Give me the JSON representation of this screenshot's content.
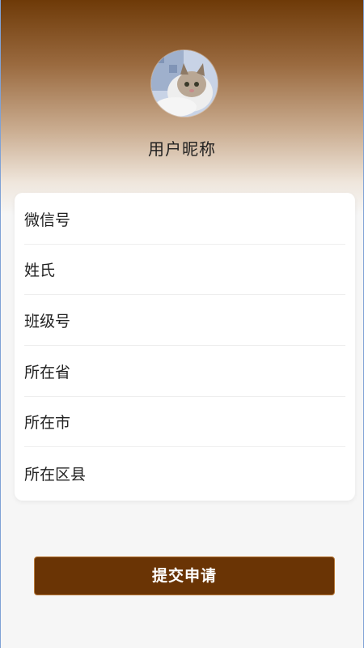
{
  "header": {
    "nickname": "用户昵称",
    "avatar": "cat-photo"
  },
  "form": {
    "fields": [
      {
        "label": "微信号"
      },
      {
        "label": "姓氏"
      },
      {
        "label": "班级号"
      },
      {
        "label": "所在省"
      },
      {
        "label": "所在市"
      },
      {
        "label": "所在区县"
      }
    ]
  },
  "actions": {
    "submit_label": "提交申请"
  },
  "colors": {
    "brand": "#6a3405",
    "background": "#f6f6f6"
  }
}
